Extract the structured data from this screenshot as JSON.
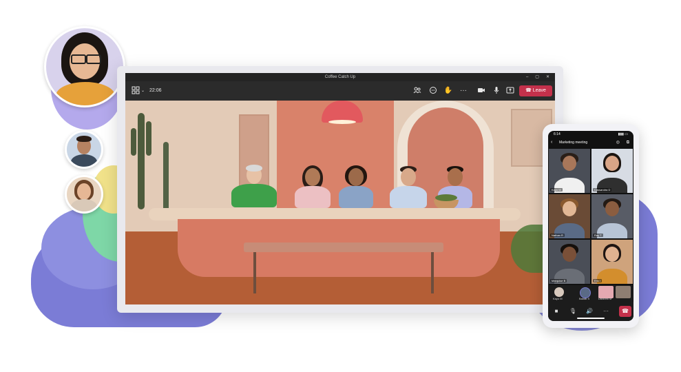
{
  "window": {
    "title": "Coffee Catch Up",
    "controls": [
      "–",
      "▢",
      "✕"
    ]
  },
  "toolbar": {
    "layout_icon": "grid-icon",
    "timer": "22:06",
    "actions": [
      "people-icon",
      "chat-icon",
      "raise-hand-icon",
      "more-icon",
      "camera-icon",
      "mic-icon",
      "share-icon"
    ],
    "leave_label": "Leave"
  },
  "phone": {
    "time": "6:14",
    "meeting_title": "Marketing meeting",
    "participants": [
      {
        "name": "Kayo M"
      },
      {
        "name": "Cassandra D"
      },
      {
        "name": "Nathan R"
      },
      {
        "name": "Ray T"
      },
      {
        "name": "Marquise B"
      },
      {
        "name": "Eric I"
      }
    ],
    "bottom_avatars": [
      {
        "name": "Kayo M"
      },
      {
        "name": "Babak S"
      },
      {
        "name": "Lakshmi M"
      }
    ],
    "bottom_bar": [
      "camera-icon",
      "mic-icon",
      "speaker-icon",
      "more-icon",
      "end-call-icon"
    ]
  },
  "colors": {
    "brand_purple": "#7b7cd6",
    "leave_red": "#c4314b",
    "wall": "#e3cbb7",
    "table": "#d77a63"
  }
}
